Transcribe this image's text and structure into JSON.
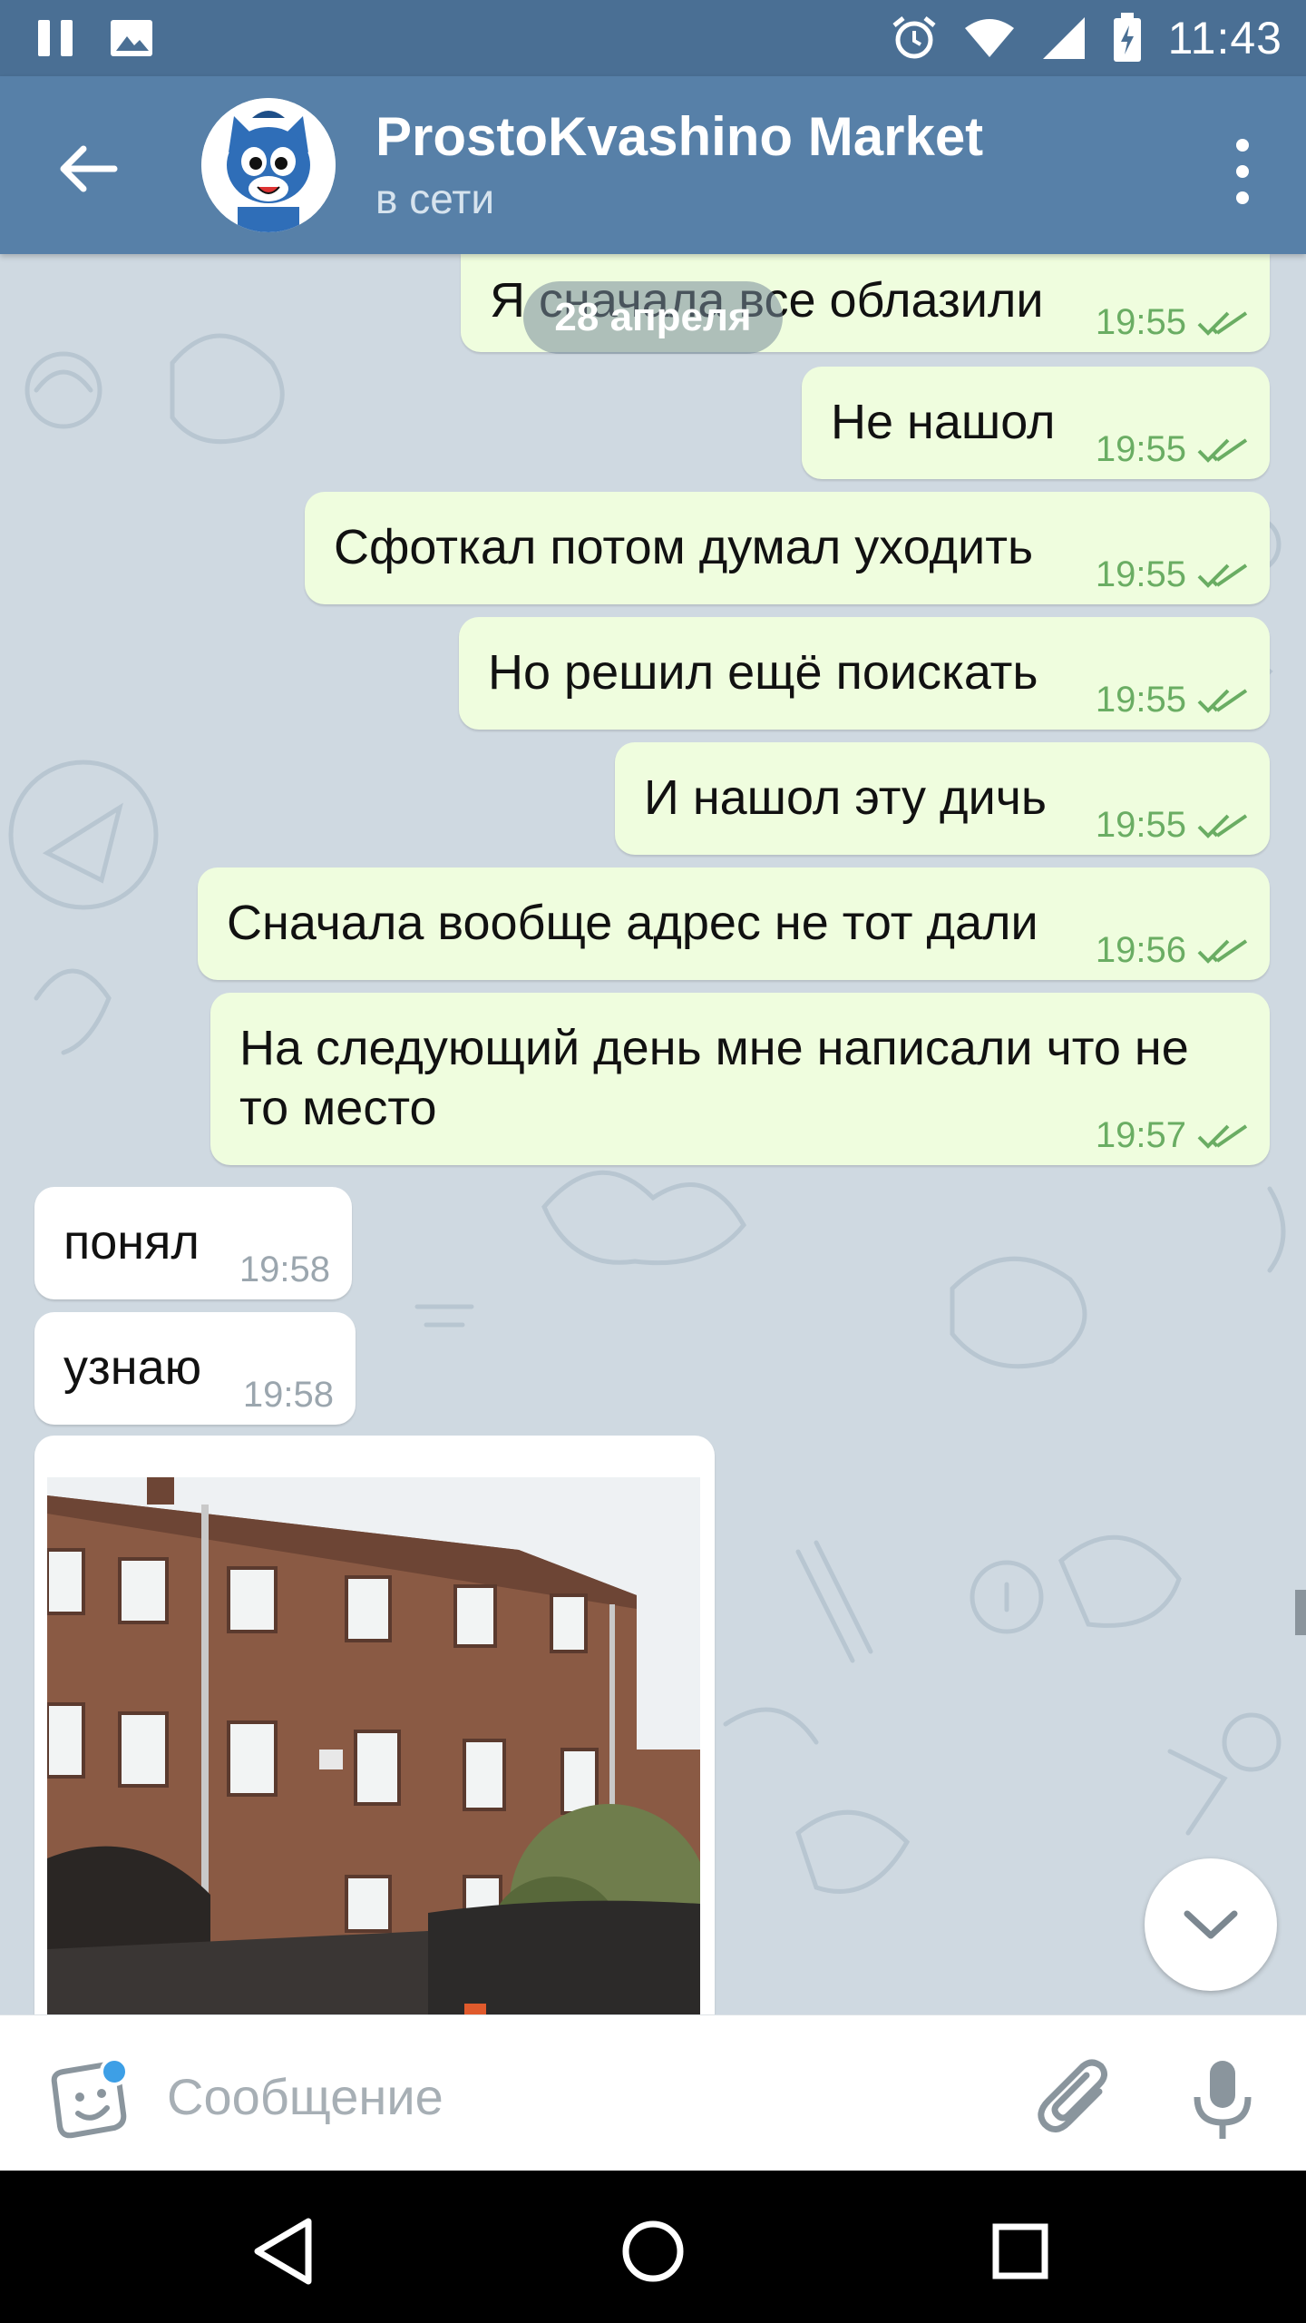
{
  "status_bar": {
    "time": "11:43"
  },
  "header": {
    "title": "ProstoKvashino Market",
    "status": "в сети"
  },
  "chat": {
    "date_separator": "28 апреля",
    "messages": [
      {
        "dir": "out",
        "text": "Я сначала все облазили",
        "time": "19:55",
        "read": true
      },
      {
        "dir": "out",
        "text": "Не нашол",
        "time": "19:55",
        "read": true
      },
      {
        "dir": "out",
        "text": "Сфоткал потом думал уходить",
        "time": "19:55",
        "read": true
      },
      {
        "dir": "out",
        "text": "Но решил ещё поискать",
        "time": "19:55",
        "read": true
      },
      {
        "dir": "out",
        "text": "И нашол эту дичь",
        "time": "19:55",
        "read": true
      },
      {
        "dir": "out",
        "text": "Сначала вообще адрес не тот дали",
        "time": "19:56",
        "read": true
      },
      {
        "dir": "out",
        "text_line1": "На следующий день мне написали что не",
        "text_line2": "то место",
        "time": "19:57",
        "read": true
      },
      {
        "dir": "in",
        "text": "понял",
        "time": "19:58"
      },
      {
        "dir": "in",
        "text": "узнаю",
        "time": "19:58"
      }
    ]
  },
  "composer": {
    "placeholder": "Сообщение"
  },
  "colors": {
    "status_bar": "#4a6f94",
    "app_bar": "#5780a8",
    "outgoing_bubble": "#effdde",
    "incoming_bubble": "#ffffff",
    "read_tick": "#6aad63",
    "chat_background": "#cfd9e1",
    "unread_dot": "#3d9fe6"
  },
  "icons": {
    "status_left": [
      "pause-icon",
      "image-icon"
    ],
    "status_right": [
      "alarm-icon",
      "wifi-icon",
      "signal-icon",
      "battery-charging-icon"
    ],
    "header": [
      "back-arrow-icon",
      "more-vertical-icon"
    ],
    "composer": [
      "sticker-icon",
      "paperclip-icon",
      "microphone-icon"
    ],
    "nav": [
      "nav-back-icon",
      "nav-home-icon",
      "nav-recents-icon"
    ]
  }
}
